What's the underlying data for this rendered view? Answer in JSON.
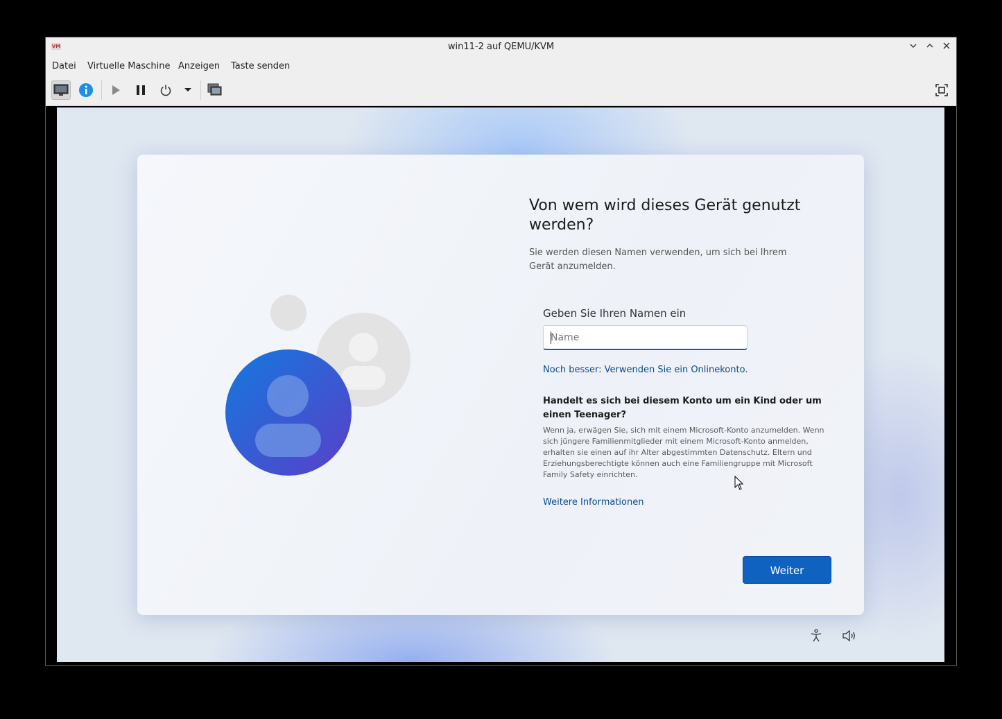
{
  "window": {
    "title": "win11-2 auf QEMU/KVM",
    "logo_text": "VM",
    "controls": [
      "minimize",
      "maximize",
      "close"
    ]
  },
  "menubar": {
    "items": [
      "Datei",
      "Virtuelle Maschine",
      "Anzeigen",
      "Taste senden"
    ]
  },
  "toolbar": {
    "buttons": [
      "console-icon",
      "info-icon",
      "play-icon",
      "pause-icon",
      "power-icon",
      "dropdown-icon",
      "snapshot-icon",
      "fullscreen-icon"
    ],
    "info_color": "#1f8ee8"
  },
  "setup": {
    "heading": "Von wem wird dieses Gerät genutzt werden?",
    "subtext": "Sie werden diesen Namen verwenden, um sich bei Ihrem Gerät anzumelden.",
    "field_label": "Geben Sie Ihren Namen ein",
    "name_placeholder": "Name",
    "name_value": "",
    "online_link": "Noch besser: Verwenden Sie ein Onlinekonto.",
    "teen_heading": "Handelt es sich bei diesem Konto um ein Kind oder um einen Teenager?",
    "teen_text": "Wenn ja, erwägen Sie, sich mit einem Microsoft-Konto anzumelden. Wenn sich jüngere Familienmitglieder mit einem Microsoft-Konto anmelden, erhalten sie einen auf ihr Alter abgestimmten Datenschutz. Eltern und Erziehungsberechtigte können auch eine Familiengruppe mit Microsoft Family Safety einrichten.",
    "more_info_link": "Weitere Informationen",
    "next_button": "Weiter",
    "accent_color": "#0f62c0",
    "link_color": "#0b4a8c"
  },
  "footer_icons": [
    "accessibility-icon",
    "volume-icon"
  ]
}
